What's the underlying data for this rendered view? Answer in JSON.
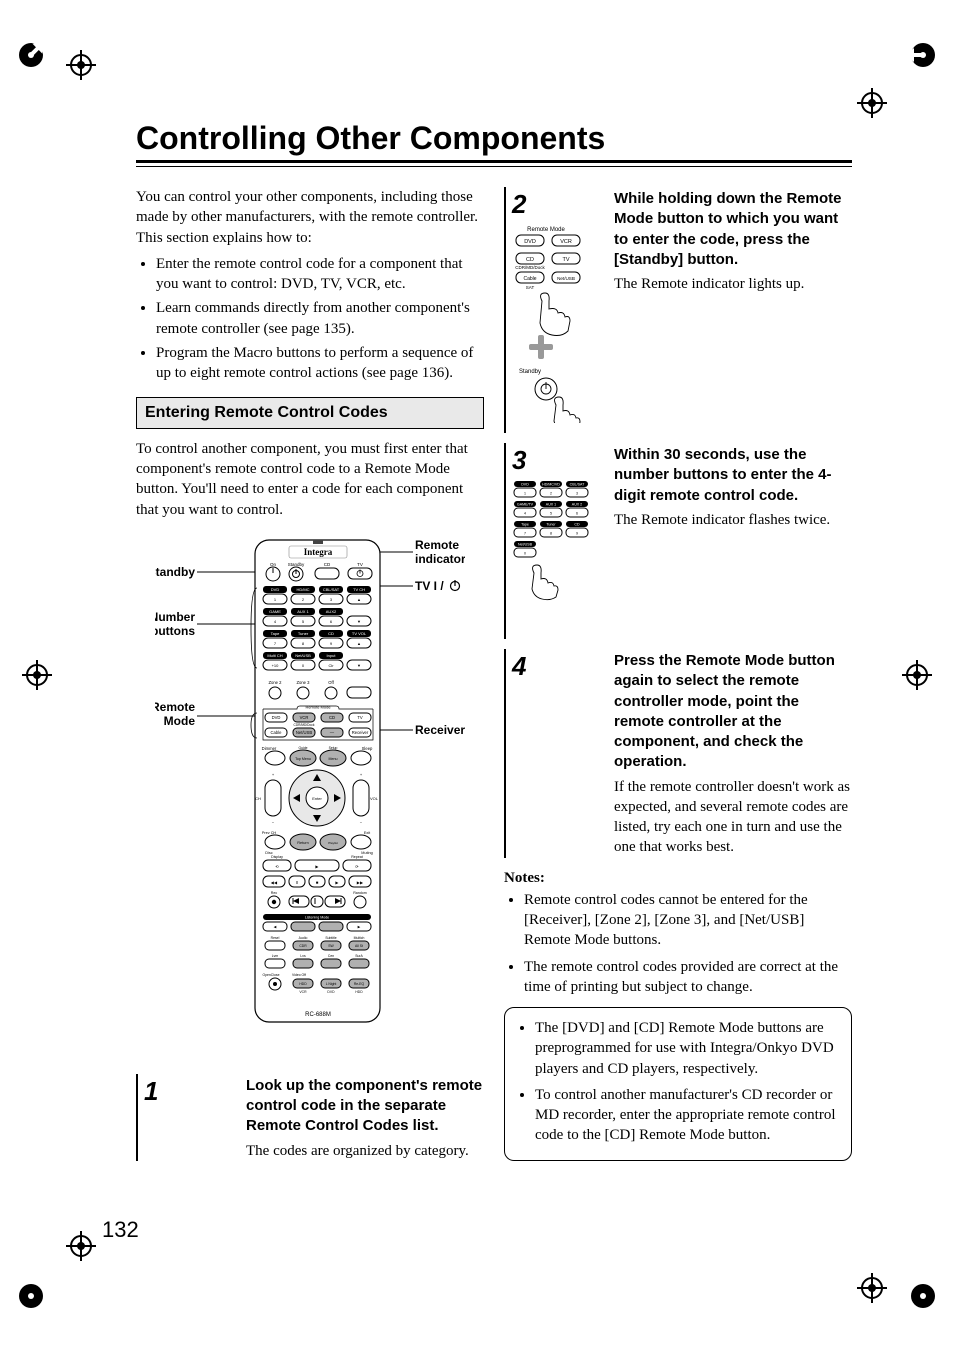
{
  "title": "Controlling Other Components",
  "pageNumber": "132",
  "intro": {
    "p1": "You can control your other components, including those made by other manufacturers, with the remote controller. This section explains how to:",
    "bullets": [
      "Enter the remote control code for a component that you want to control: DVD, TV, VCR, etc.",
      "Learn commands directly from another component's remote controller (see page 135).",
      "Program the Macro buttons to perform a sequence of up to eight remote control actions (see page 136)."
    ]
  },
  "section": {
    "head": "Entering Remote Control Codes",
    "p1": "To control another component, you must first enter that component's remote control code to a Remote Mode button. You'll need to enter a code for each component that you want to control."
  },
  "remoteFig": {
    "labels": {
      "standby": "Standby",
      "number": "Number\nbuttons",
      "remoteMode": "Remote\nMode",
      "remoteIndicator": "Remote\nindicator",
      "tv": "TV",
      "receiver": "Receiver",
      "model": "RC-688M",
      "brand": "Integra"
    },
    "btnLabels": {
      "on": "On",
      "standby": "Standby",
      "dvd": "DVD",
      "hdmcvd": "HD/MC/VD",
      "cbl_sat": "CBL/SAT",
      "game_tv": "GAME/TV",
      "aux1": "AUX 1",
      "aux2": "AUX2",
      "tape": "Tape",
      "tuner": "Tuner",
      "cd": "CD",
      "netusb": "Net/USB",
      "tvch": "TV CH",
      "tvvol": "TV VOL",
      "multich": "Multi CH",
      "input": "Input",
      "zone2": "Zone 2",
      "zone3": "Zone 3",
      "off": "Off",
      "remoteMode": "Remote Mode",
      "vcr": "VCR",
      "tv": "TV",
      "cable": "Cable",
      "cdrmd": "CDR/MD/Dock",
      "receiver": "Receiver",
      "dimmer": "Dimmer",
      "sleep": "Sleep",
      "topmenu": "Top Menu",
      "menu": "Menu",
      "guide": "Guide",
      "setup": "Setup",
      "ch": "CH",
      "vol": "VOL",
      "enter": "Enter",
      "return": "Return",
      "prevch": "Prev CH",
      "exit": "Exit",
      "disc": "Disc",
      "muting": "Muting",
      "display": "Display",
      "repeat": "Repeat",
      "rec": "Rec",
      "random": "Random",
      "listening": "Listening Mode",
      "openclose": "OpenClose",
      "videooff": "Video Off",
      "lnight": "L Night",
      "resel": "Re-EQ",
      "audio": "Audio",
      "subtitle": "Subtitle",
      "cdr": "CDR",
      "allst": "All St",
      "hdd": "HDD",
      "vcr2": "VCR",
      "dvd2": "DVD"
    }
  },
  "steps": {
    "s1": {
      "num": "1",
      "head": "Look up the component's remote control code in the separate Remote Control Codes list.",
      "body": "The codes are organized by category."
    },
    "s2": {
      "num": "2",
      "head": "While holding down the Remote Mode button to which you want to enter the code, press the [Standby] button.",
      "body": "The Remote indicator lights up.",
      "fig": {
        "title": "Remote Mode",
        "buttons": [
          "DVD",
          "VCR",
          "CD",
          "TV",
          "Cable",
          "Net/USB"
        ],
        "sublabels": [
          "CDR/MD/Dock",
          "SAT"
        ],
        "standby": "Standby"
      }
    },
    "s3": {
      "num": "3",
      "head": "Within 30 seconds, use the number buttons to enter the 4-digit remote control code.",
      "body": "The Remote indicator flashes twice.",
      "fig": {
        "numLabels": [
          "DVD",
          "HD/MC/VD",
          "CBL/SAT",
          "GAME/TV",
          "AUX 1",
          "AUX 2",
          "Tape",
          "Tuner",
          "CD",
          "Net/USB"
        ],
        "numbers": [
          "1",
          "2",
          "3",
          "4",
          "5",
          "6",
          "7",
          "8",
          "9",
          "0"
        ]
      }
    },
    "s4": {
      "num": "4",
      "head": "Press the Remote Mode button again to select the remote controller mode, point the remote controller at the component, and check the operation.",
      "body": "If the remote controller doesn't work as expected, and several remote codes are listed, try each one in turn and use the one that works best."
    }
  },
  "notes": {
    "head": "Notes:",
    "items": [
      "Remote control codes cannot be entered for the [Receiver], [Zone 2], [Zone 3], and [Net/USB] Remote Mode buttons.",
      "The remote control codes provided are correct at the time of printing but subject to change."
    ],
    "boxed": [
      "The [DVD] and [CD] Remote Mode buttons are preprogrammed for use with Integra/Onkyo DVD players and CD players, respectively.",
      "To control another manufacturer's CD recorder or MD recorder, enter the appropriate remote control code to the [CD] Remote Mode button."
    ]
  }
}
